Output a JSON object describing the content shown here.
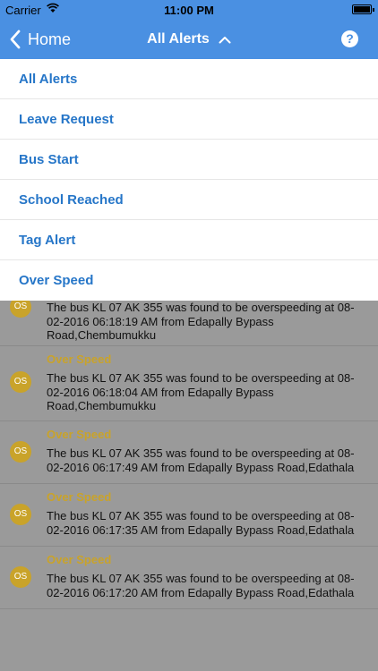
{
  "status": {
    "carrier": "Carrier",
    "time": "11:00 PM",
    "battery_level": 1.0
  },
  "nav": {
    "back_label": "Home",
    "title": "All Alerts",
    "help": "?"
  },
  "dropdown": {
    "items": [
      {
        "label": "All Alerts"
      },
      {
        "label": "Leave Request"
      },
      {
        "label": "Bus Start"
      },
      {
        "label": "School Reached"
      },
      {
        "label": "Tag Alert"
      },
      {
        "label": "Over Speed"
      }
    ]
  },
  "alerts": [
    {
      "icon": "OS",
      "title": "",
      "text": "The bus KL 07 AK 355 was found to be overspeeding at 08-02-2016 06:18:19 AM from Edapally Bypass Road,Chembumukku"
    },
    {
      "icon": "OS",
      "title": "Over Speed",
      "text": "The bus KL 07 AK 355 was found to be overspeeding at 08-02-2016 06:18:04 AM from Edapally Bypass Road,Chembumukku"
    },
    {
      "icon": "OS",
      "title": "Over Speed",
      "text": "The bus KL 07 AK 355 was found to be overspeeding at 08-02-2016 06:17:49 AM from Edapally Bypass Road,Edathala"
    },
    {
      "icon": "OS",
      "title": "Over Speed",
      "text": "The bus KL 07 AK 355 was found to be overspeeding at 08-02-2016 06:17:35 AM from Edapally Bypass Road,Edathala"
    },
    {
      "icon": "OS",
      "title": "Over Speed",
      "text": "The bus KL 07 AK 355 was found to be overspeeding at 08-02-2016 06:17:20 AM from Edapally Bypass Road,Edathala"
    }
  ],
  "colors": {
    "nav_bg": "#4a90e2",
    "dropdown_text": "#2676c8",
    "alert_accent": "#c9a32a",
    "overlay_bg": "#9a9a9a"
  }
}
